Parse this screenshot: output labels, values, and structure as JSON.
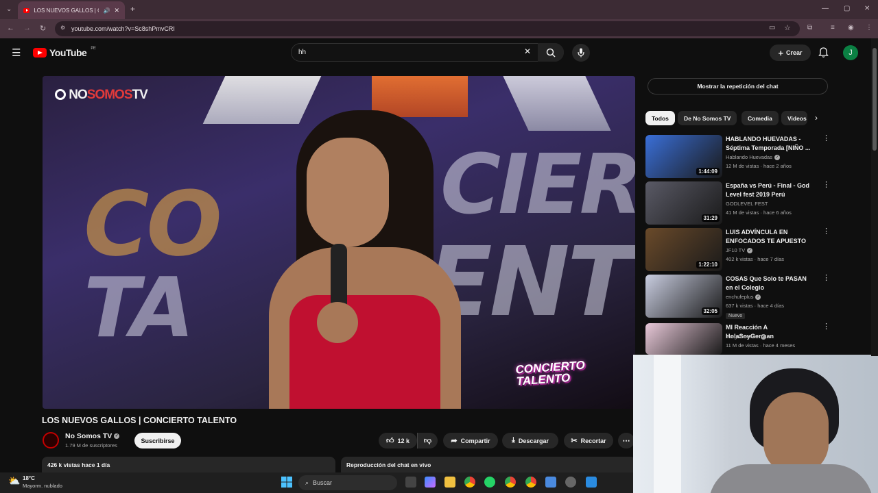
{
  "browser": {
    "tab_title": "LOS NUEVOS GALLOS | CO",
    "url": "youtube.com/watch?v=Sc8shPmvCRI",
    "new_tab": "+"
  },
  "youtube": {
    "logo_text": "YouTube",
    "region": "PE",
    "search_value": "hh",
    "create_label": "Crear",
    "avatar_letter": "J"
  },
  "video": {
    "overlay_logo_a": "NO",
    "overlay_logo_b": "SOMOS",
    "overlay_logo_c": "TV",
    "overlay_badge_line1": "CONCIERTO",
    "overlay_badge_line2": "TALENTO",
    "title": "LOS NUEVOS GALLOS | CONCIERTO TALENTO",
    "channel": "No Somos TV",
    "subscribers": "1.79 M de suscriptores",
    "subscribe_label": "Suscribirse",
    "likes": "12 k",
    "share_label": "Compartir",
    "download_label": "Descargar",
    "clip_label": "Recortar",
    "views_date": "426 k vistas  hace 1 día",
    "chat_replay_label": "Reproducción del chat en vivo"
  },
  "sidebar": {
    "show_chat_label": "Mostrar la repetición del chat",
    "chips": [
      "Todos",
      "De No Somos TV",
      "Comedia",
      "Videos"
    ],
    "recommendations": [
      {
        "title": "HABLANDO HUEVADAS - Séptima Temporada [NIÑO ...",
        "channel": "Hablando Huevadas",
        "verified": true,
        "meta": "12 M de vistas · hace 2 años",
        "duration": "1:44:09",
        "thumb_color": "#3a6fd8"
      },
      {
        "title": "España vs Perú - Final - God Level fest 2019 Perú",
        "channel": "GODLEVEL FEST",
        "verified": false,
        "meta": "41 M de vistas · hace 6 años",
        "duration": "31:29",
        "thumb_color": "#5a5a66"
      },
      {
        "title": "LUIS ADVÍNCULA EN ENFOCADOS TE APUESTO CO...",
        "channel": "JF10 TV",
        "verified": true,
        "meta": "402 k vistas · hace 7 días",
        "duration": "1:22:10",
        "thumb_color": "#6a4a2a"
      },
      {
        "title": "COSAS Que Solo te PASAN en el Colegio",
        "channel": "enchufeplus",
        "verified": true,
        "meta": "637 k vistas · hace 4 días",
        "duration": "32:05",
        "thumb_color": "#c9cde0",
        "badge": "Nuevo"
      },
      {
        "title": "MI Reacción A HolaSoyGerman",
        "channel": "JuegaGerman",
        "verified": true,
        "meta": "11 M de vistas · hace 4 meses",
        "duration": "",
        "thumb_color": "#e8c8d8"
      }
    ]
  },
  "taskbar": {
    "temperature": "18°C",
    "weather": "Mayorm. nublado",
    "search_label": "Buscar"
  }
}
